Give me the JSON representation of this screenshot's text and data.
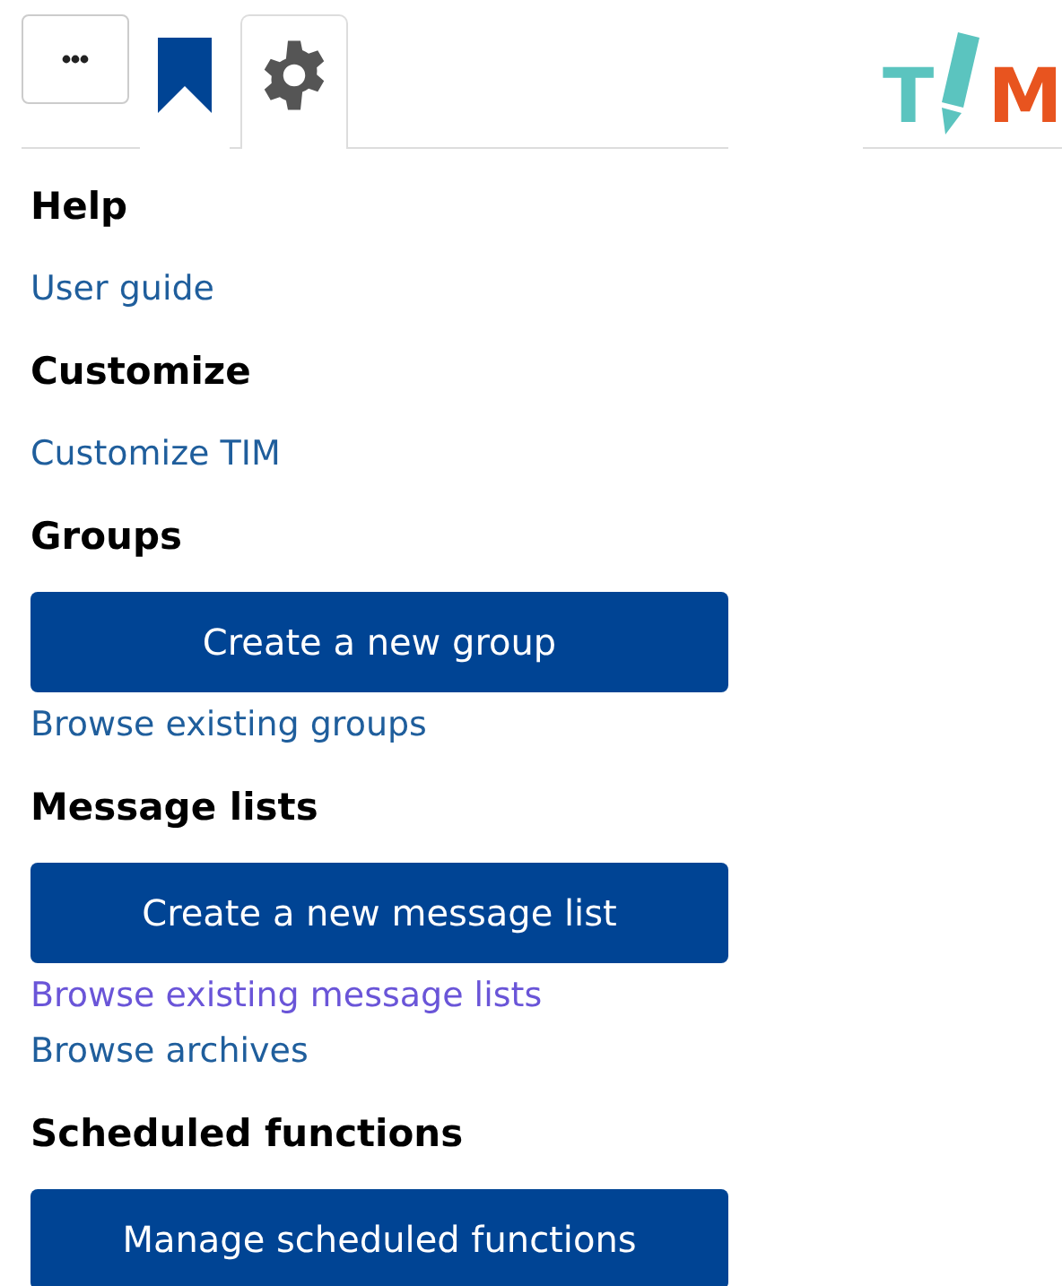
{
  "tabs": [
    {
      "kind": "more",
      "selected": false
    },
    {
      "kind": "bookmarks",
      "selected": false
    },
    {
      "kind": "settings",
      "selected": true
    }
  ],
  "logo": {
    "first": "T",
    "last": "M"
  },
  "sections": [
    {
      "heading": "Help",
      "items": [
        {
          "kind": "link",
          "text": "User guide",
          "visited": false
        }
      ]
    },
    {
      "heading": "Customize",
      "items": [
        {
          "kind": "link",
          "text": "Customize TIM",
          "visited": false
        }
      ]
    },
    {
      "heading": "Groups",
      "items": [
        {
          "kind": "button",
          "text": "Create a new group"
        },
        {
          "kind": "link",
          "text": "Browse existing groups",
          "visited": false
        }
      ]
    },
    {
      "heading": "Message lists",
      "items": [
        {
          "kind": "button",
          "text": "Create a new message list"
        },
        {
          "kind": "link",
          "text": "Browse existing message lists",
          "visited": true
        },
        {
          "kind": "link",
          "text": "Browse archives",
          "visited": false
        }
      ]
    },
    {
      "heading": "Scheduled functions",
      "items": [
        {
          "kind": "button",
          "text": "Manage scheduled functions"
        }
      ]
    }
  ]
}
